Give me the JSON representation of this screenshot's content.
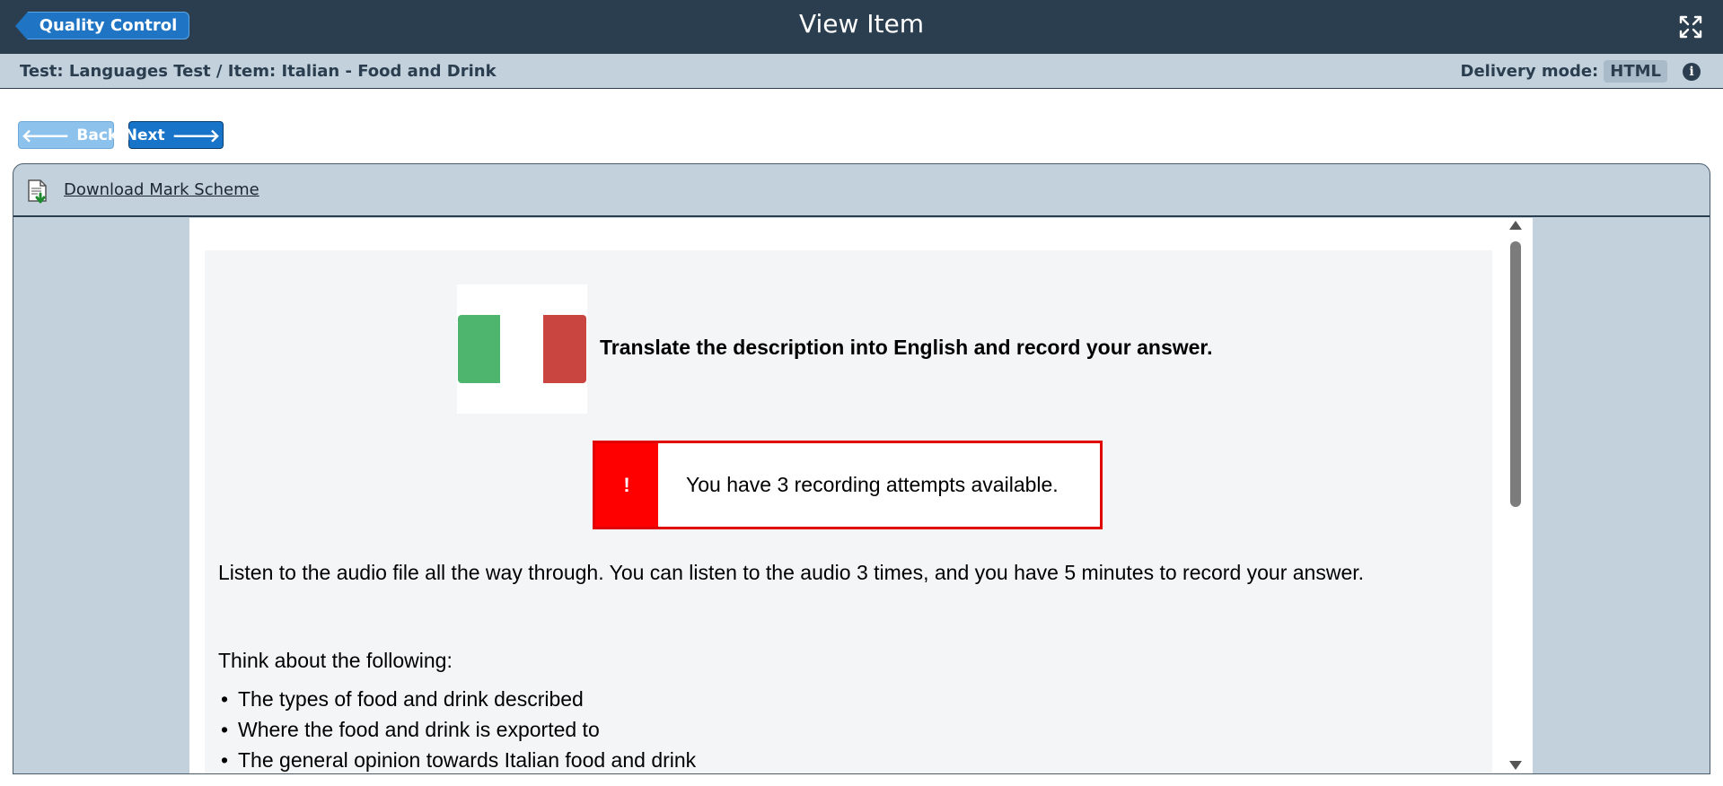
{
  "topbar": {
    "back_label": "Quality Control",
    "title": "View Item",
    "expand_icon": "expand-icon"
  },
  "breadcrumb": {
    "text": "Test: Languages Test / Item: Italian - Food and Drink",
    "delivery_label": "Delivery mode:",
    "delivery_value": "HTML",
    "info_glyph": "i"
  },
  "nav": {
    "back_label": "Back",
    "next_label": "Next",
    "back_arrow": "🡐",
    "next_arrow": "🡒"
  },
  "panel": {
    "download_label": "Download Mark Scheme"
  },
  "question": {
    "instruction": "Translate the description into English and record your answer.",
    "alert_icon": "!",
    "alert_text": "You have 3 recording attempts available.",
    "paragraph": "Listen to the audio file all the way through. You can listen to the audio 3 times, and you have 5 minutes to record your answer.",
    "think_label": "Think about the following:",
    "bullets": [
      "The types of food and drink described",
      "Where the food and drink is exported to",
      "The general opinion towards Italian food and drink"
    ]
  },
  "colors": {
    "topbar": "#2a3e4f",
    "accent": "#1774c8",
    "alert": "#ff0000",
    "flag_green": "#4db56d",
    "flag_red": "#c9453f"
  }
}
